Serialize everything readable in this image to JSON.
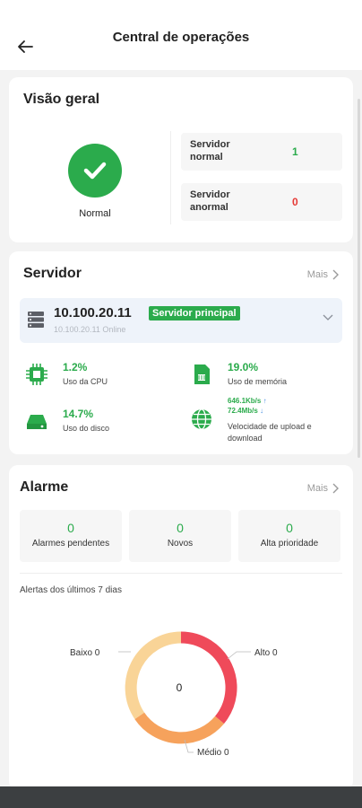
{
  "header": {
    "title": "Central de operações"
  },
  "overview": {
    "title": "Visão geral",
    "status": "Normal",
    "normal_label": "Servidor normal",
    "normal_count": "1",
    "abnormal_label": "Servidor anormal",
    "abnormal_count": "0",
    "colors": {
      "ok": "#2bab4c",
      "bad": "#e53935"
    }
  },
  "server": {
    "title": "Servidor",
    "more": "Mais",
    "ip": "10.100.20.11",
    "badge": "Servidor principal",
    "sub": "10.100.20.11 Online",
    "cpu_value": "1.2%",
    "cpu_label": "Uso da CPU",
    "mem_value": "19.0%",
    "mem_label": "Uso de memória",
    "disk_value": "14.7%",
    "disk_label": "Uso do disco",
    "upload": "646.1Kb/s",
    "download": "72.4Mb/s",
    "net_label": "Velocidade de upload e download"
  },
  "alarm": {
    "title": "Alarme",
    "more": "Mais",
    "pending_count": "0",
    "pending_label": "Alarmes pendentes",
    "new_count": "0",
    "new_label": "Novos",
    "high_count": "0",
    "high_label": "Alta prioridade",
    "subtitle": "Alertas dos últimos 7 dias",
    "donut_center": "0",
    "low_label": "Baixo 0",
    "high_seg_label": "Alto 0",
    "medium_label": "Médio 0",
    "segment_colors": {
      "high": "#ef4a5a",
      "medium": "#f6a25c",
      "low": "#f9d497"
    }
  }
}
